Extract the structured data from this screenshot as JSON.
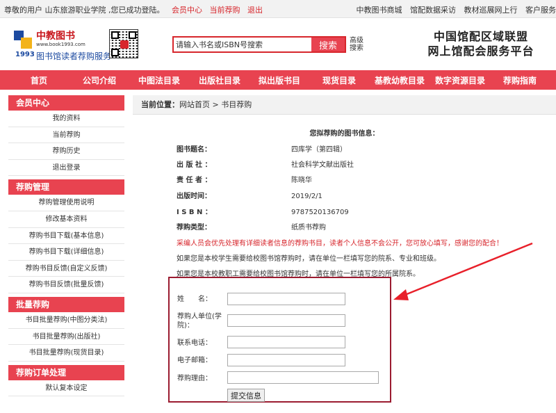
{
  "topbar": {
    "welcome": "尊敬的用户 山东旅游职业学院 ,您已成功登陆。",
    "links": [
      "会员中心",
      "当前荐购",
      "退出"
    ],
    "right_links": [
      "中教图书商城",
      "馆配数据采访",
      "教材巡展网上行",
      "客户服务"
    ]
  },
  "logo": {
    "brand": "中教图书",
    "url": "www.book1993.com",
    "year": "1993",
    "sub": "图书馆读者荐购服务"
  },
  "search": {
    "placeholder": "请输入书名或ISBN号搜索",
    "button": "搜索",
    "advanced": "高级搜索"
  },
  "slogan": {
    "line1": "中国馆配区域联盟",
    "line2": "网上馆配会服务平台"
  },
  "nav": [
    "首页",
    "公司介绍",
    "中图法目录",
    "出版社目录",
    "拟出版书目",
    "现货目录",
    "基教幼教目录",
    "数字资源目录",
    "荐购指南"
  ],
  "sidebar": {
    "sections": [
      {
        "title": "会员中心",
        "items": [
          "我的资料",
          "当前荐购",
          "荐购历史",
          "退出登录"
        ]
      },
      {
        "title": "荐购管理",
        "items": [
          "荐购管理使用说明",
          "修改基本资料",
          "荐购书目下载(基本信息)",
          "荐购书目下载(详细信息)",
          "荐购书目反馈(自定义反馈)",
          "荐购书目反馈(批量反馈)"
        ]
      },
      {
        "title": "批量荐购",
        "items": [
          "书目批量荐购(中图分类法)",
          "书目批量荐购(出版社)",
          "书目批量荐购(现货目录)"
        ]
      },
      {
        "title": "荐购订单处理",
        "items": [
          "默认复本设定"
        ]
      }
    ]
  },
  "breadcrumb": {
    "label": "当前位置：",
    "path": "网站首页 > 书目荐购"
  },
  "book": {
    "heading": "您拟荐购的图书信息：",
    "fields": [
      {
        "label": "图书题名：",
        "value": "四库学（第四辑）"
      },
      {
        "label": "出 版 社 ：",
        "value": "社会科学文献出版社"
      },
      {
        "label": "责 任 者 ：",
        "value": "陈晓华"
      },
      {
        "label": "出版时间：",
        "value": "2019/2/1"
      },
      {
        "label": "I S B N ：",
        "value": "9787520136709"
      },
      {
        "label": "荐购类型：",
        "value": "纸质书荐购"
      }
    ]
  },
  "notes": {
    "privacy": "采编人员会优先处理有详细读者信息的荐购书目，读者个人信息不会公开，您可放心填写，感谢您的配合！",
    "student": "如果您是本校学生需要给校图书馆荐购时，请在单位一栏填写您的院系、专业和班级。",
    "staff": "如果您是本校教职工需要给校图书馆荐购时，请在单位一栏填写您的所属院系。"
  },
  "form": {
    "name_label": "姓　　名：",
    "unit_label": "荐购人单位(学院)：",
    "phone_label": "联系电话：",
    "email_label": "电子邮箱：",
    "reason_label": "荐购理由：",
    "submit": "提交信息"
  },
  "colors": {
    "accent_red": "#e84350",
    "form_border": "#9b1b30",
    "notice_red": "#d7262c"
  }
}
